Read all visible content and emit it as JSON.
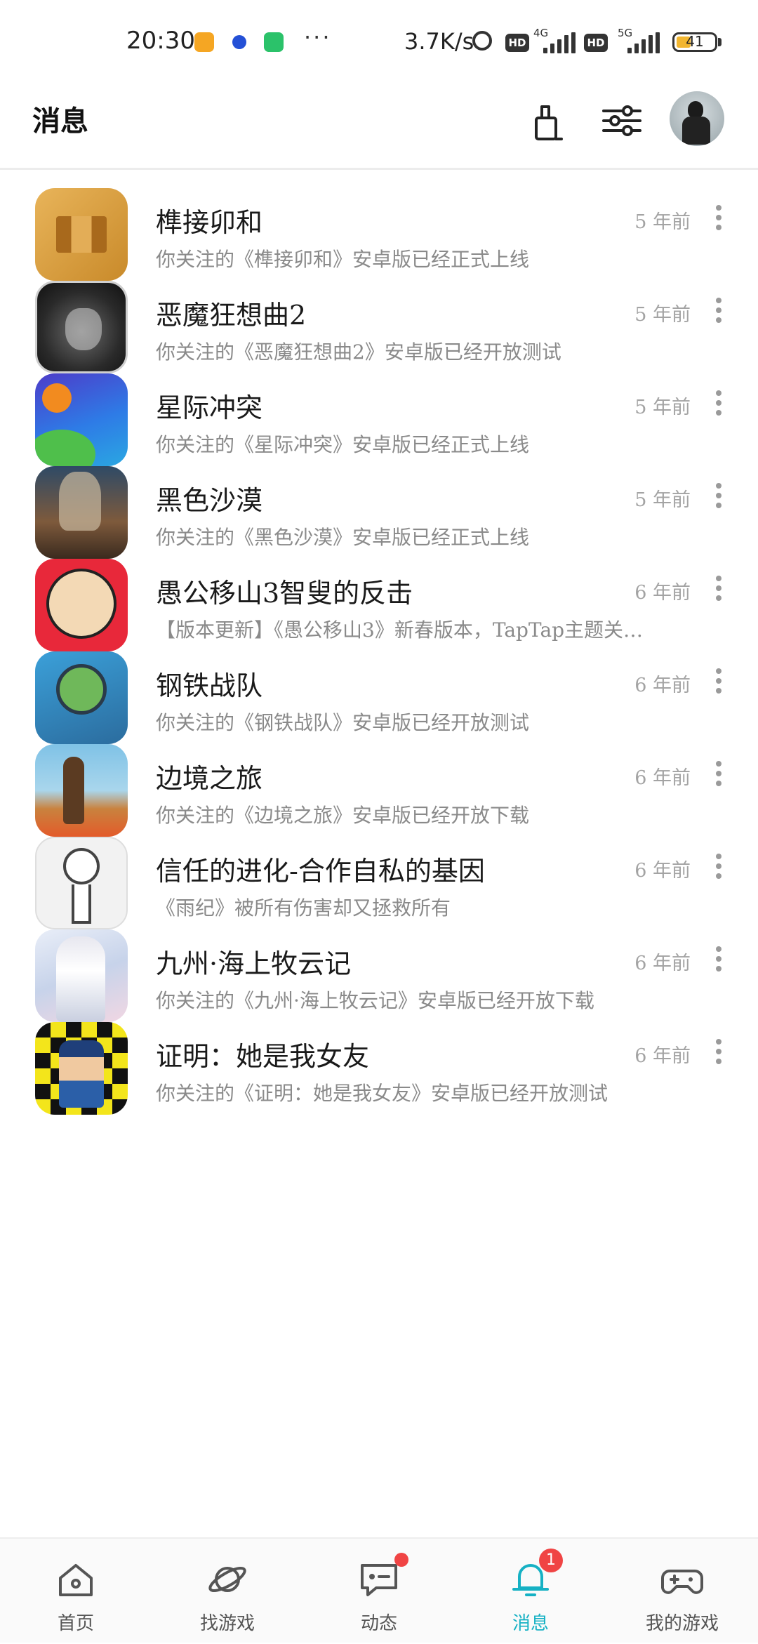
{
  "status_bar": {
    "time": "20:30",
    "more": "···",
    "net_speed": "3.7K/s",
    "hd1": "HD",
    "net1": "4G",
    "hd2": "HD",
    "net2": "5G",
    "battery": "41",
    "icons": [
      "notification-app-icon",
      "notification-app-icon",
      "notification-app-icon",
      "alarm-icon",
      "signal-icon",
      "battery-icon"
    ]
  },
  "header": {
    "title": "消息",
    "icons": [
      "clean-icon",
      "filter-icon",
      "avatar"
    ]
  },
  "messages": [
    {
      "icon": "game-icon-sunmao",
      "title": "榫接卯和",
      "desc": "你关注的《榫接卯和》安卓版已经正式上线",
      "time": "5 年前"
    },
    {
      "icon": "game-icon-demon",
      "title": "恶魔狂想曲2",
      "desc": "你关注的《恶魔狂想曲2》安卓版已经开放测试",
      "time": "5 年前"
    },
    {
      "icon": "game-icon-star-conflict",
      "title": "星际冲突",
      "desc": "你关注的《星际冲突》安卓版已经正式上线",
      "time": "5 年前"
    },
    {
      "icon": "game-icon-black-desert",
      "title": "黑色沙漠",
      "desc": "你关注的《黑色沙漠》安卓版已经正式上线",
      "time": "5 年前"
    },
    {
      "icon": "game-icon-yugong",
      "title": "愚公移山3智叟的反击",
      "desc": "【版本更新】《愚公移山3》新春版本，TapTap主题关…",
      "time": "6 年前"
    },
    {
      "icon": "game-icon-steel-squad",
      "title": "钢铁战队",
      "desc": "你关注的《钢铁战队》安卓版已经开放测试",
      "time": "6 年前"
    },
    {
      "icon": "game-icon-border-journey",
      "title": "边境之旅",
      "desc": "你关注的《边境之旅》安卓版已经开放下载",
      "time": "6 年前"
    },
    {
      "icon": "game-icon-evolution-trust",
      "title": "信任的进化-合作自私的基因",
      "desc": "《雨纪》被所有伤害却又拯救所有",
      "time": "6 年前"
    },
    {
      "icon": "game-icon-jiuzhou",
      "title": "九州·海上牧云记",
      "desc": "你关注的《九州·海上牧云记》安卓版已经开放下载",
      "time": "6 年前"
    },
    {
      "icon": "game-icon-police",
      "title": "证明：她是我女友",
      "desc": "你关注的《证明：她是我女友》安卓版已经开放测试",
      "time": "6 年前"
    }
  ],
  "bottom_nav": [
    {
      "label": "首页",
      "icon": "home-icon"
    },
    {
      "label": "找游戏",
      "icon": "planet-icon"
    },
    {
      "label": "动态",
      "icon": "feed-icon"
    },
    {
      "label": "消息",
      "icon": "bell-icon",
      "badge": "1",
      "active": true
    },
    {
      "label": "我的游戏",
      "icon": "gamepad-icon"
    }
  ],
  "colors": {
    "accent": "#16b1c4",
    "badge": "#f04444",
    "time_text": "#a3a3a3",
    "desc_text": "#8a8a8a"
  }
}
